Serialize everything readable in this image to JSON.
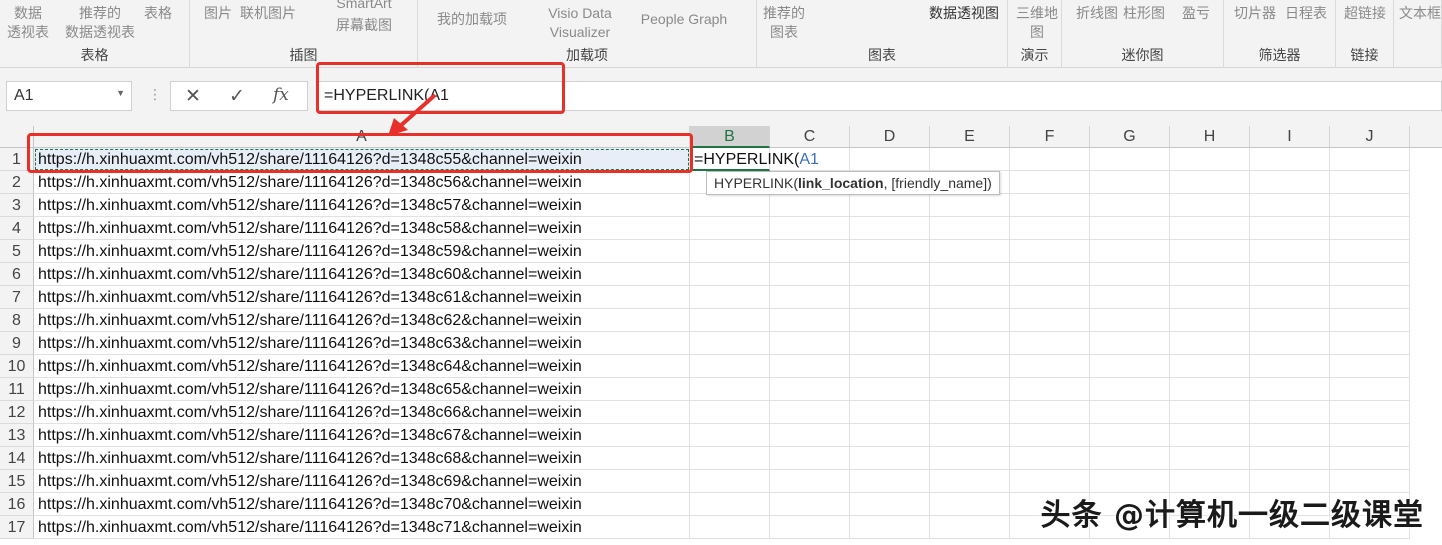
{
  "ribbon": {
    "groups": [
      {
        "label": "表格",
        "items": [
          "数据\n透视表",
          "推荐的\n数据透视表",
          "表格"
        ]
      },
      {
        "label": "插图",
        "items": [
          "图片",
          "联机图片",
          "SmartArt",
          "屏幕截图"
        ]
      },
      {
        "label": "加载项",
        "items": [
          "我的加载项",
          "Visio Data\nVisualizer",
          "People Graph"
        ]
      },
      {
        "label": "图表",
        "items": [
          "推荐的\n图表",
          "数据透视图"
        ]
      },
      {
        "label": "演示",
        "items": [
          "三维地\n图"
        ]
      },
      {
        "label": "迷你图",
        "items": [
          "折线图",
          "柱形图",
          "盈亏"
        ]
      },
      {
        "label": "筛选器",
        "items": [
          "切片器",
          "日程表"
        ]
      },
      {
        "label": "链接",
        "items": [
          "超链接"
        ]
      },
      {
        "label": "",
        "items": [
          "文本框"
        ]
      }
    ]
  },
  "formula_bar": {
    "name_box": "A1",
    "cancel": "✕",
    "enter": "✓",
    "fx": "fx",
    "formula": "=HYPERLINK(A1"
  },
  "columns": [
    "A",
    "B",
    "C",
    "D",
    "E",
    "F",
    "G",
    "H",
    "I",
    "J"
  ],
  "rows": [
    {
      "n": "1",
      "a": "https://h.xinhuaxmt.com/vh512/share/11164126?d=1348c55&channel=weixin"
    },
    {
      "n": "2",
      "a": "https://h.xinhuaxmt.com/vh512/share/11164126?d=1348c56&channel=weixin"
    },
    {
      "n": "3",
      "a": "https://h.xinhuaxmt.com/vh512/share/11164126?d=1348c57&channel=weixin"
    },
    {
      "n": "4",
      "a": "https://h.xinhuaxmt.com/vh512/share/11164126?d=1348c58&channel=weixin"
    },
    {
      "n": "5",
      "a": "https://h.xinhuaxmt.com/vh512/share/11164126?d=1348c59&channel=weixin"
    },
    {
      "n": "6",
      "a": "https://h.xinhuaxmt.com/vh512/share/11164126?d=1348c60&channel=weixin"
    },
    {
      "n": "7",
      "a": "https://h.xinhuaxmt.com/vh512/share/11164126?d=1348c61&channel=weixin"
    },
    {
      "n": "8",
      "a": "https://h.xinhuaxmt.com/vh512/share/11164126?d=1348c62&channel=weixin"
    },
    {
      "n": "9",
      "a": "https://h.xinhuaxmt.com/vh512/share/11164126?d=1348c63&channel=weixin"
    },
    {
      "n": "10",
      "a": "https://h.xinhuaxmt.com/vh512/share/11164126?d=1348c64&channel=weixin"
    },
    {
      "n": "11",
      "a": "https://h.xinhuaxmt.com/vh512/share/11164126?d=1348c65&channel=weixin"
    },
    {
      "n": "12",
      "a": "https://h.xinhuaxmt.com/vh512/share/11164126?d=1348c66&channel=weixin"
    },
    {
      "n": "13",
      "a": "https://h.xinhuaxmt.com/vh512/share/11164126?d=1348c67&channel=weixin"
    },
    {
      "n": "14",
      "a": "https://h.xinhuaxmt.com/vh512/share/11164126?d=1348c68&channel=weixin"
    },
    {
      "n": "15",
      "a": "https://h.xinhuaxmt.com/vh512/share/11164126?d=1348c69&channel=weixin"
    },
    {
      "n": "16",
      "a": "https://h.xinhuaxmt.com/vh512/share/11164126?d=1348c70&channel=weixin"
    },
    {
      "n": "17",
      "a": "https://h.xinhuaxmt.com/vh512/share/11164126?d=1348c71&channel=weixin"
    }
  ],
  "b1": {
    "prefix": "=HYPERLINK(",
    "ref": "A1"
  },
  "tooltip": {
    "fn": "HYPERLINK(",
    "arg1": "link_location",
    ",": ", ",
    "arg2": "[friendly_name])"
  },
  "watermark": "头条 @计算机一级二级课堂",
  "colors": {
    "accent": "#217346",
    "highlight": "#e8302a",
    "ref_blue": "#3c6fbf"
  }
}
